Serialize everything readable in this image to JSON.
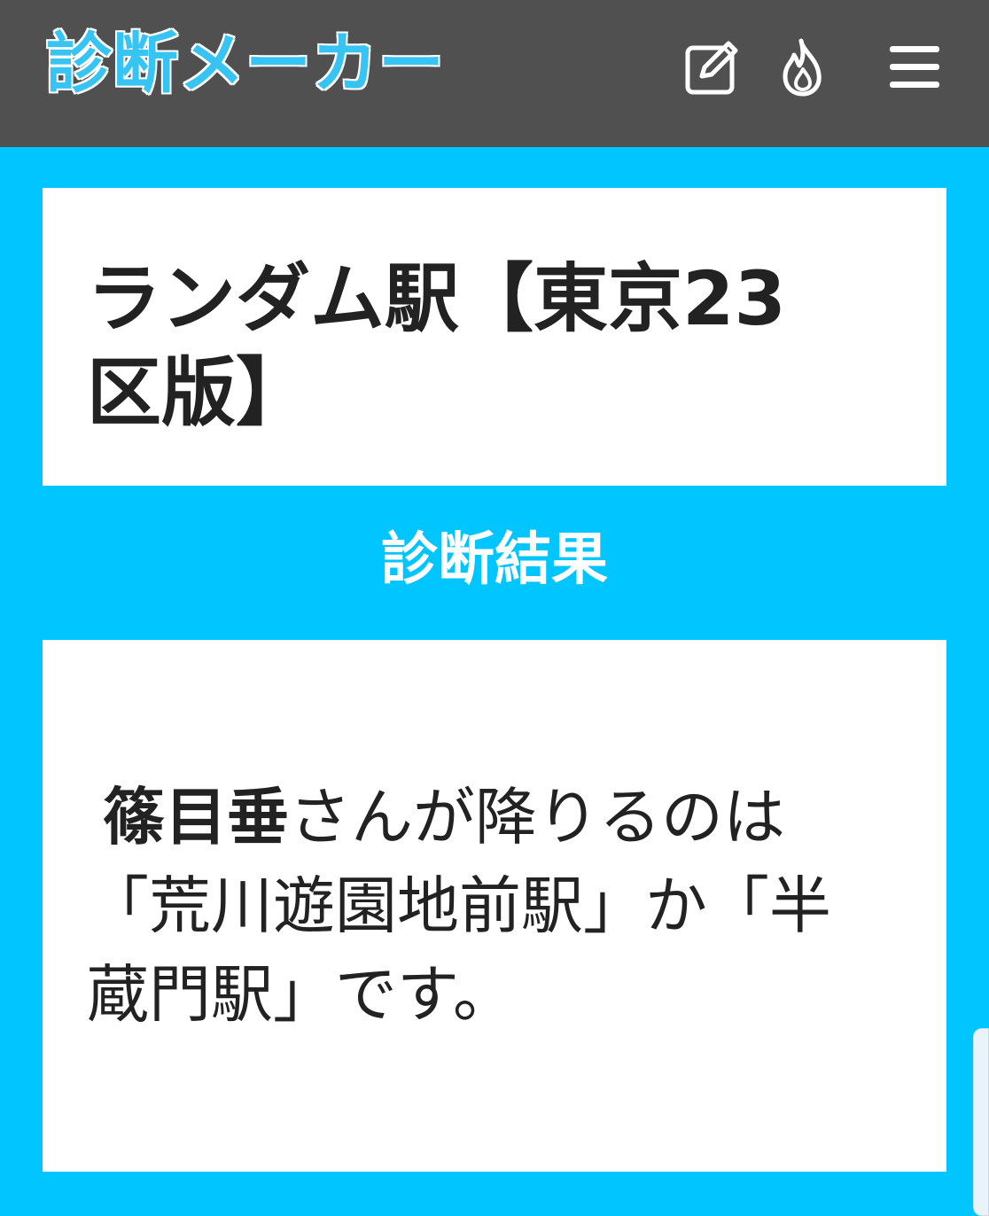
{
  "header": {
    "logo": "診断メーカー",
    "edit_icon": "edit-icon",
    "fire_icon": "fire-icon",
    "menu_icon": "hamburger-menu-icon"
  },
  "diagnosis": {
    "title": "ランダム駅【東京23区版】"
  },
  "result": {
    "section_label": "診断結果",
    "name": "篠目垂",
    "text": "さんが降りるのは「荒川遊園地前駅」か「半蔵門駅」です。"
  },
  "colors": {
    "background": "#00c5ff",
    "header": "#505050",
    "logo": "#37c4f2",
    "card": "#ffffff",
    "text": "#222222"
  }
}
